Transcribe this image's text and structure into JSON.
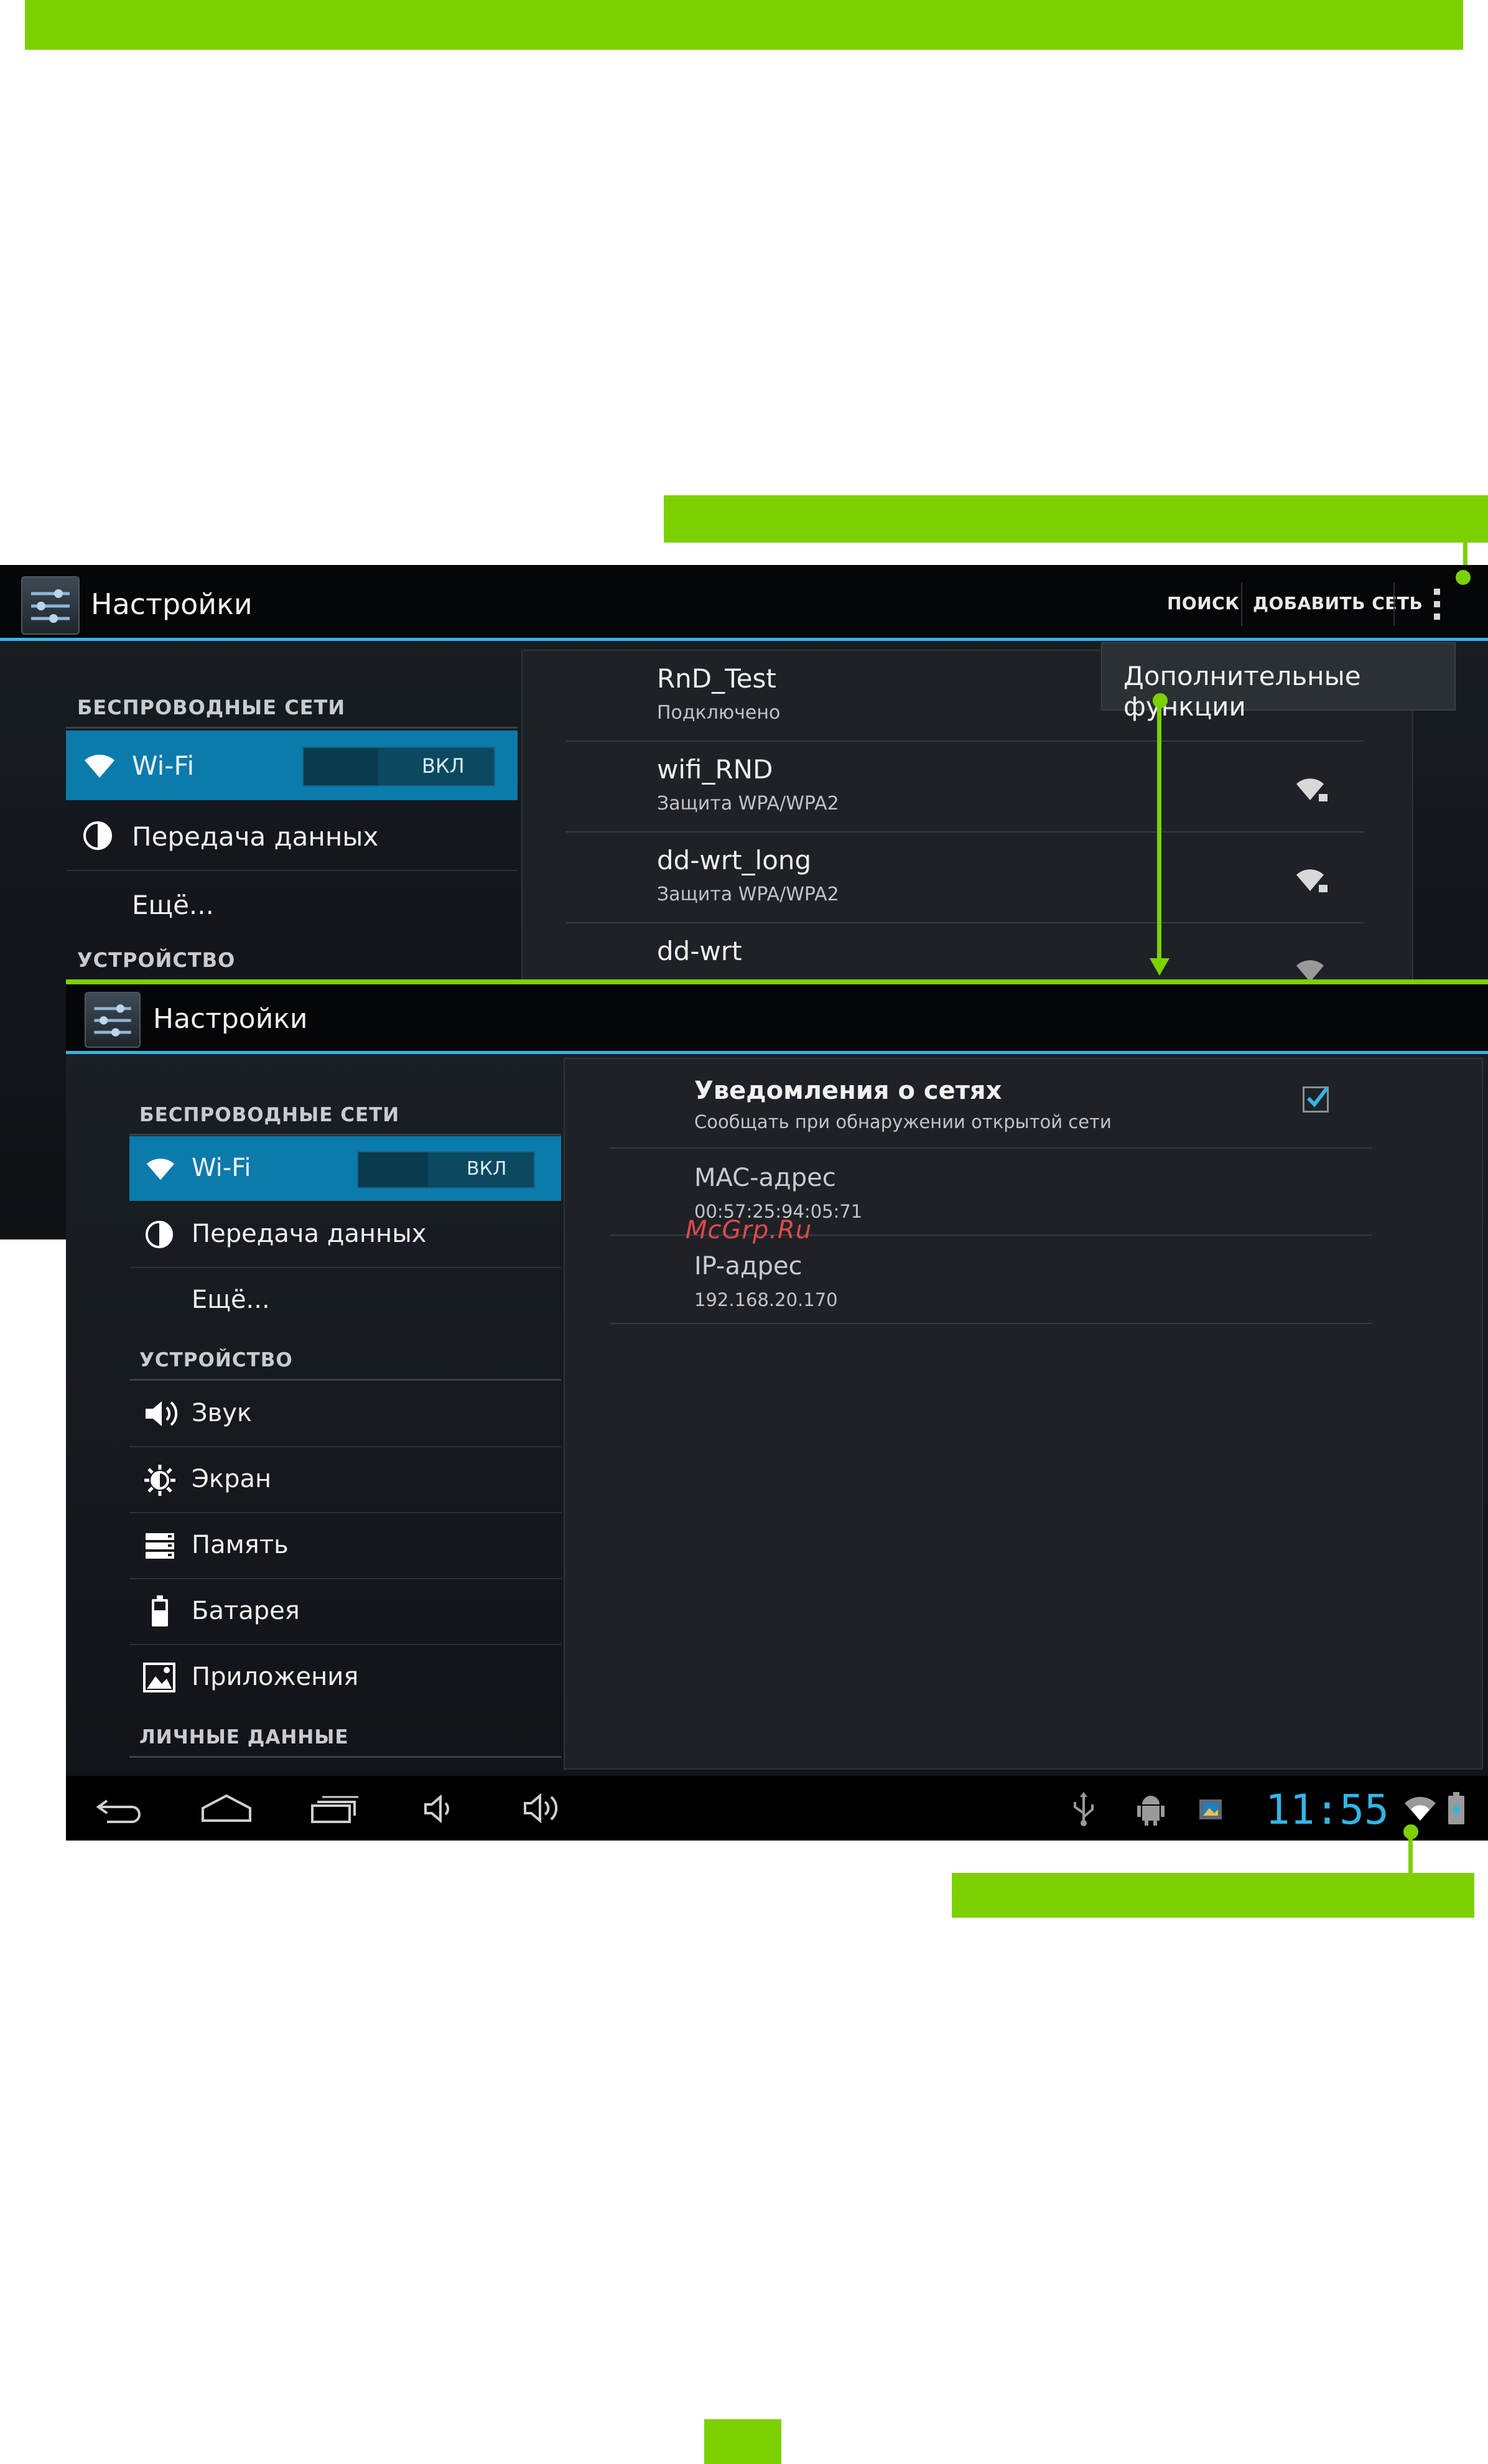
{
  "app_title": "Настройки",
  "top_screen": {
    "actions": {
      "search": "ПОИСК",
      "add_network": "ДОБАВИТЬ СЕТЬ"
    },
    "popup": "Дополнительные функции",
    "sidebar": {
      "category_wireless": "БЕСПРОВОДНЫЕ СЕТИ",
      "wifi_label": "Wi-Fi",
      "wifi_toggle": "ВКЛ",
      "data_usage": "Передача данных",
      "more": "Ещё...",
      "category_device": "УСТРОЙСТВО"
    },
    "networks": [
      {
        "name": "RnD_Test",
        "status": "Подключено"
      },
      {
        "name": "wifi_RND",
        "status": "Защита WPA/WPA2"
      },
      {
        "name": "dd-wrt_long",
        "status": "Защита WPA/WPA2"
      },
      {
        "name": "dd-wrt",
        "status": ""
      }
    ]
  },
  "bottom_screen": {
    "sidebar": {
      "category_wireless": "БЕСПРОВОДНЫЕ СЕТИ",
      "wifi_label": "Wi-Fi",
      "wifi_toggle": "ВКЛ",
      "data_usage": "Передача данных",
      "more": "Ещё...",
      "category_device": "УСТРОЙСТВО",
      "sound": "Звук",
      "display": "Экран",
      "storage": "Память",
      "battery": "Батарея",
      "apps": "Приложения",
      "category_personal": "ЛИЧНЫЕ ДАННЫЕ"
    },
    "advanced": {
      "notify_title": "Уведомления о сетях",
      "notify_sub": "Сообщать при обнаружении открытой сети",
      "notify_checked": true,
      "mac_title": "MAC-адрес",
      "mac_value": "00:57:25:94:05:71",
      "ip_title": "IP-адрес",
      "ip_value": "192.168.20.170"
    },
    "status_bar": {
      "time": "11:55"
    }
  },
  "watermark": "McGrp.Ru",
  "colors": {
    "accent_green": "#7dd000",
    "holo_blue": "#33b5e5",
    "selected_blue": "#0a7bab"
  },
  "icons": [
    "settings-icon",
    "overflow-menu-icon",
    "wifi-icon",
    "data-usage-icon",
    "sound-icon",
    "display-icon",
    "storage-icon",
    "battery-icon",
    "apps-icon",
    "back-icon",
    "home-icon",
    "recents-icon",
    "volume-down-icon",
    "volume-up-icon",
    "usb-icon",
    "android-debug-icon",
    "image-icon",
    "wifi-signal-icon",
    "battery-charging-icon"
  ]
}
